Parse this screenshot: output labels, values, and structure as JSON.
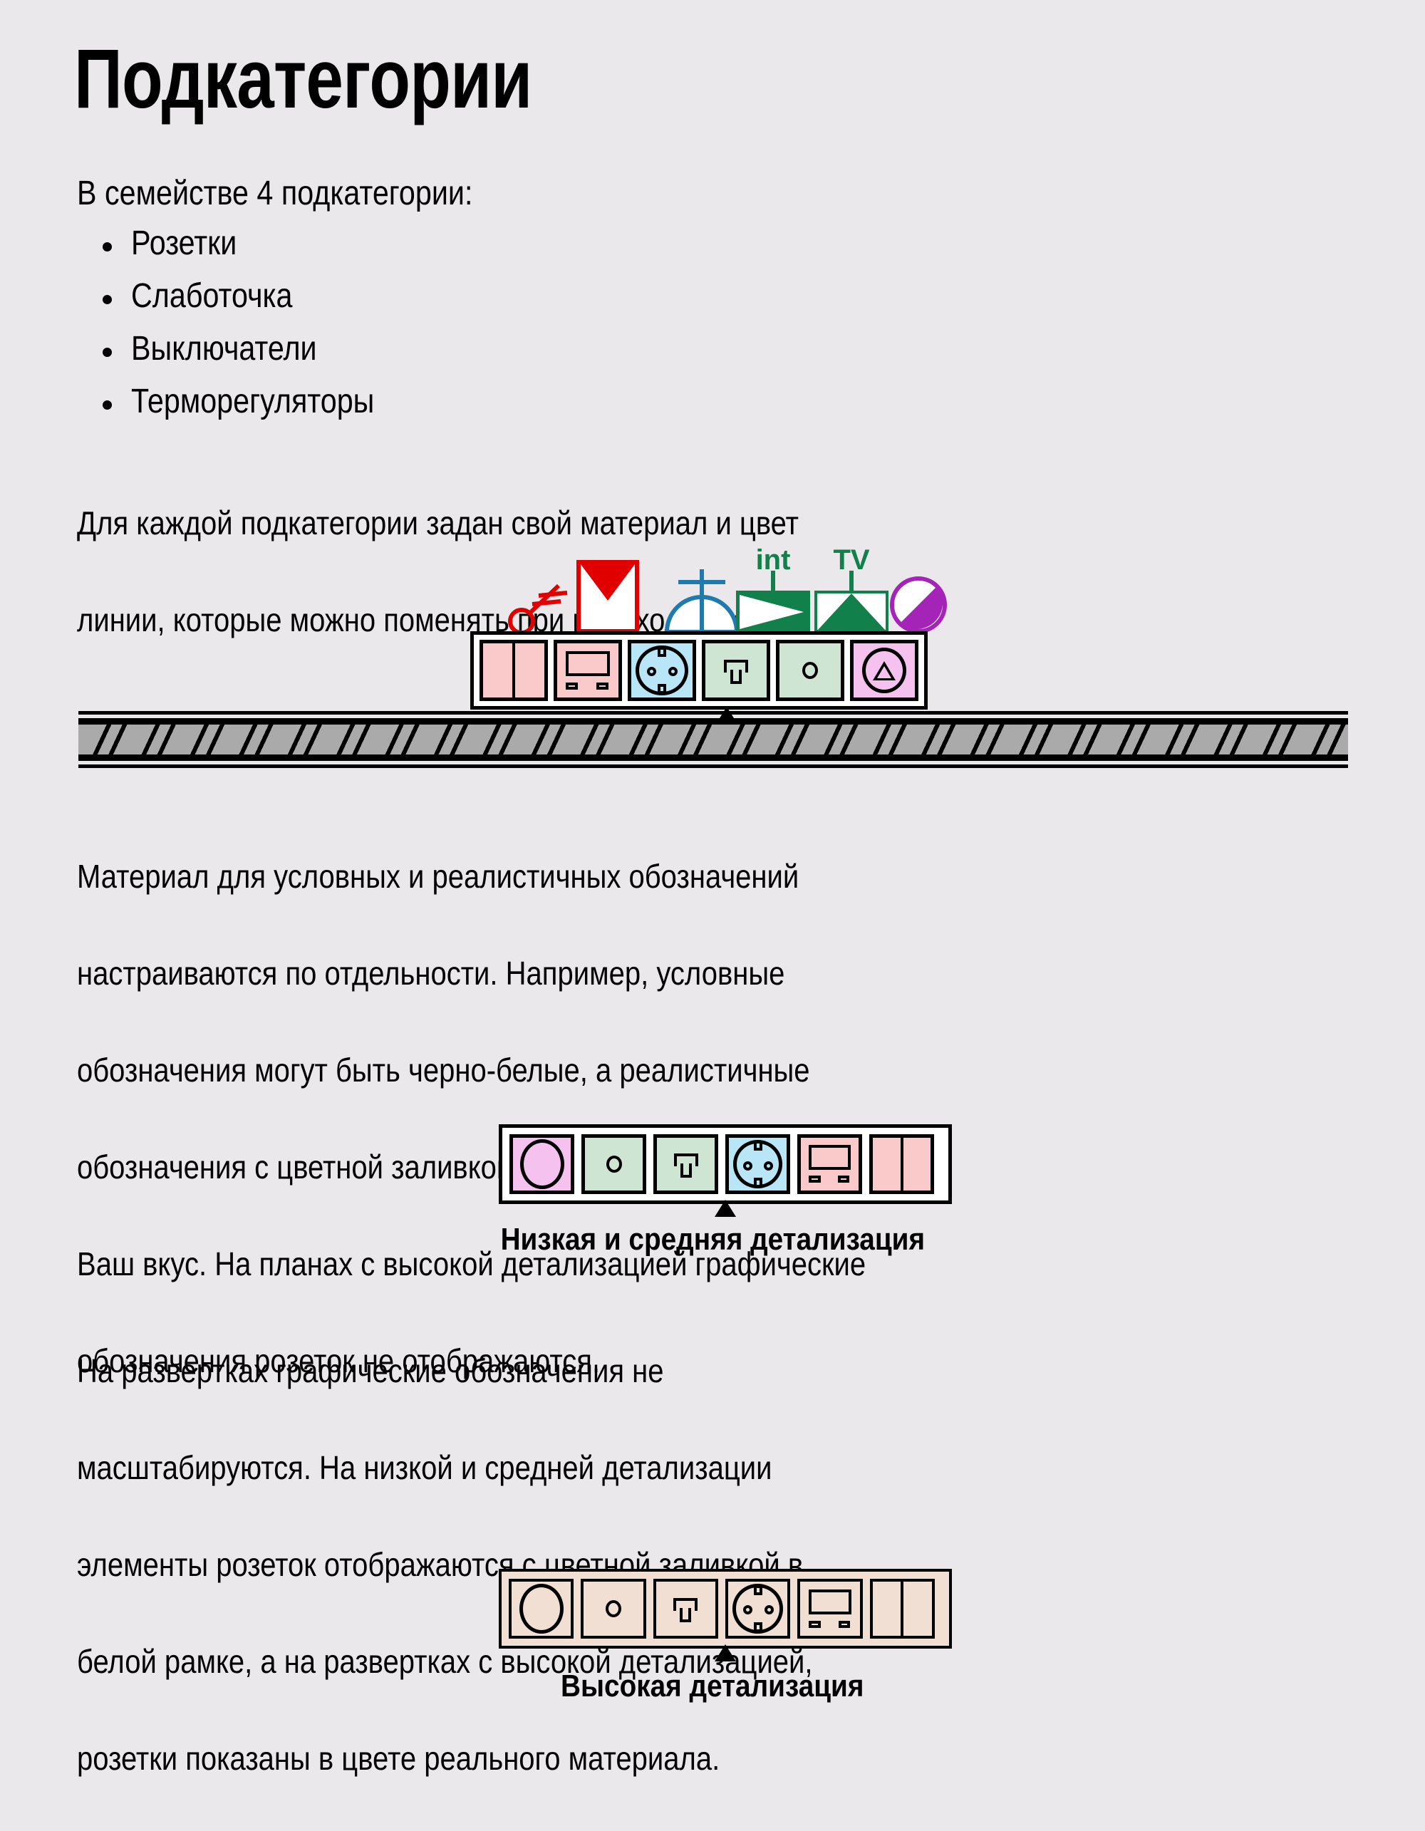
{
  "page": {
    "title": "Подкатегории",
    "background_color": "#eae8ea",
    "intro": "В семействе 4 подкатегории:",
    "bullets": [
      "Розетки",
      "Слаботочка",
      "Выключатели",
      "Терморегуляторы"
    ],
    "paragraphs": {
      "p1": [
        "Для каждой подкатегории задан свой материал и цвет",
        "линии, которые можно поменять при необходимости."
      ],
      "p2": [
        "Материал для условных и реалистичных обозначений",
        "настраиваются по отдельности. Например, условные",
        "обозначения могут быть черно-белые, а реалистичные",
        "обозначения с цветной заливкой, вариантов много, все на",
        "Ваш вкус. На планах с высокой детализацией графические",
        "обозначения розеток не отображаются."
      ],
      "p3": [
        "На развертках графические обозначения не",
        "масштабируются. На низкой и средней детализации",
        "элементы розеток отображаются с цветной заливкой в",
        "белой рамке, а на развертках с высокой детализацией,",
        "розетки показаны в цвете реального материала."
      ]
    },
    "captions": {
      "low_medium": "Низкая и средняя детализация",
      "high": "Высокая детализация"
    }
  },
  "symbols": {
    "items": [
      {
        "name": "switch-symbol",
        "label": "",
        "color": "#e00000"
      },
      {
        "name": "dimmer-symbol",
        "label": "",
        "color": "#e00000"
      },
      {
        "name": "socket-symbol",
        "label": "",
        "color": "#1f7bad"
      },
      {
        "name": "internet-symbol",
        "label": "int",
        "color": "#12804a"
      },
      {
        "name": "tv-symbol",
        "label": "TV",
        "color": "#12804a"
      },
      {
        "name": "thermostat-symbol",
        "label": "",
        "color": "#a524b8"
      }
    ]
  },
  "illustration_plan": {
    "cells": [
      {
        "name": "switch-2gang",
        "fill": "#fac9c9",
        "glyph": "switch2"
      },
      {
        "name": "thermostat",
        "fill": "#fac9c9",
        "glyph": "therm"
      },
      {
        "name": "power-socket",
        "fill": "#b8e6f7",
        "glyph": "schuko"
      },
      {
        "name": "rj45-jack",
        "fill": "#cfe5d3",
        "glyph": "rj45"
      },
      {
        "name": "coax-jack",
        "fill": "#cfe5d3",
        "glyph": "coax"
      },
      {
        "name": "dial-thermostat",
        "fill": "#f5c2ef",
        "glyph": "dial"
      }
    ],
    "wall_color": "#aaaaaa"
  },
  "illustration_low_medium": {
    "frame_fill": "#ffffff",
    "cells": [
      {
        "name": "dial-blank",
        "fill": "#f5c2ef",
        "glyph": "ellipse"
      },
      {
        "name": "coax-jack",
        "fill": "#cfe5d3",
        "glyph": "coax"
      },
      {
        "name": "rj45-jack",
        "fill": "#cfe5d3",
        "glyph": "rj45"
      },
      {
        "name": "power-socket",
        "fill": "#b8e6f7",
        "glyph": "schuko"
      },
      {
        "name": "thermostat",
        "fill": "#fac9c9",
        "glyph": "therm"
      },
      {
        "name": "switch-2gang",
        "fill": "#fac9c9",
        "glyph": "switch2"
      }
    ]
  },
  "illustration_high": {
    "frame_fill": "#f2dfd4",
    "cells": [
      {
        "name": "dial-blank",
        "fill": "#f2dfd4",
        "glyph": "ellipse"
      },
      {
        "name": "coax-jack",
        "fill": "#f2dfd4",
        "glyph": "coax"
      },
      {
        "name": "rj45-jack",
        "fill": "#f2dfd4",
        "glyph": "rj45"
      },
      {
        "name": "power-socket",
        "fill": "#f2dfd4",
        "glyph": "schuko"
      },
      {
        "name": "thermostat",
        "fill": "#f2dfd4",
        "glyph": "therm"
      },
      {
        "name": "switch-2gang",
        "fill": "#f2dfd4",
        "glyph": "switch2"
      }
    ]
  }
}
